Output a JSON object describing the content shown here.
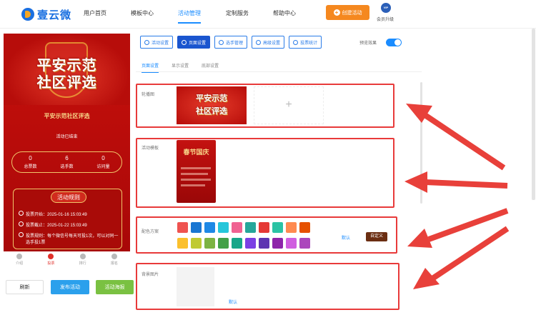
{
  "brand": {
    "name": "壹云微"
  },
  "nav": {
    "items": [
      "用户首页",
      "模板中心",
      "活动管理",
      "定制服务",
      "帮助中心"
    ],
    "create_label": "创建活动",
    "vip_badge": "VIP",
    "vip_label": "会员升级"
  },
  "preview": {
    "banner_line1": "平安示范",
    "banner_line2": "社区评选",
    "title": "平安示范社区评选",
    "status": "活动已结束",
    "stats": [
      {
        "value": "0",
        "label": "总票数"
      },
      {
        "value": "6",
        "label": "选手数"
      },
      {
        "value": "0",
        "label": "访问量"
      }
    ],
    "rules_title": "活动规则",
    "rules": [
      "投票开始：2025-01-16 15:03:49",
      "投票截止：2025-01-22 15:03:49",
      "投票规则：每个微信号每天可投1次，可以对同一选手投1票"
    ],
    "tabs": [
      "介绍",
      "投票",
      "排行",
      "报名"
    ]
  },
  "actions": {
    "refresh": "刷新",
    "publish": "发布活动",
    "poster": "活动海报"
  },
  "settings": {
    "toolbar": [
      "活动设置",
      "页面设置",
      "选手管理",
      "高级设置",
      "投票统计"
    ],
    "preview_effect": "预览效果",
    "subtabs": [
      "页面设置",
      "显示设置",
      "底部设置"
    ],
    "carousel_label": "轮播图",
    "carousel_line1": "平安示范",
    "carousel_line2": "社区评选",
    "add_symbol": "+",
    "template_label": "活动模板",
    "template_title": "春节国庆",
    "color_label": "配色方案",
    "default_label": "默认",
    "custom_label": "自定义",
    "bg_label": "背景图片",
    "bg_default": "默认",
    "colors_row1": [
      "#ef5350",
      "#1976d2",
      "#1e88e5",
      "#26c6da",
      "#f06292",
      "#26a69a",
      "#e53935",
      "#2bc3a4",
      "#ff8a50",
      "#e65100"
    ],
    "colors_row2": [
      "#fbc02d",
      "#c0ca33",
      "#7cb342",
      "#43a047",
      "#17a689",
      "#7b3fe4",
      "#5e35b1",
      "#8e24aa",
      "#d05ee0",
      "#ab47bc"
    ]
  }
}
